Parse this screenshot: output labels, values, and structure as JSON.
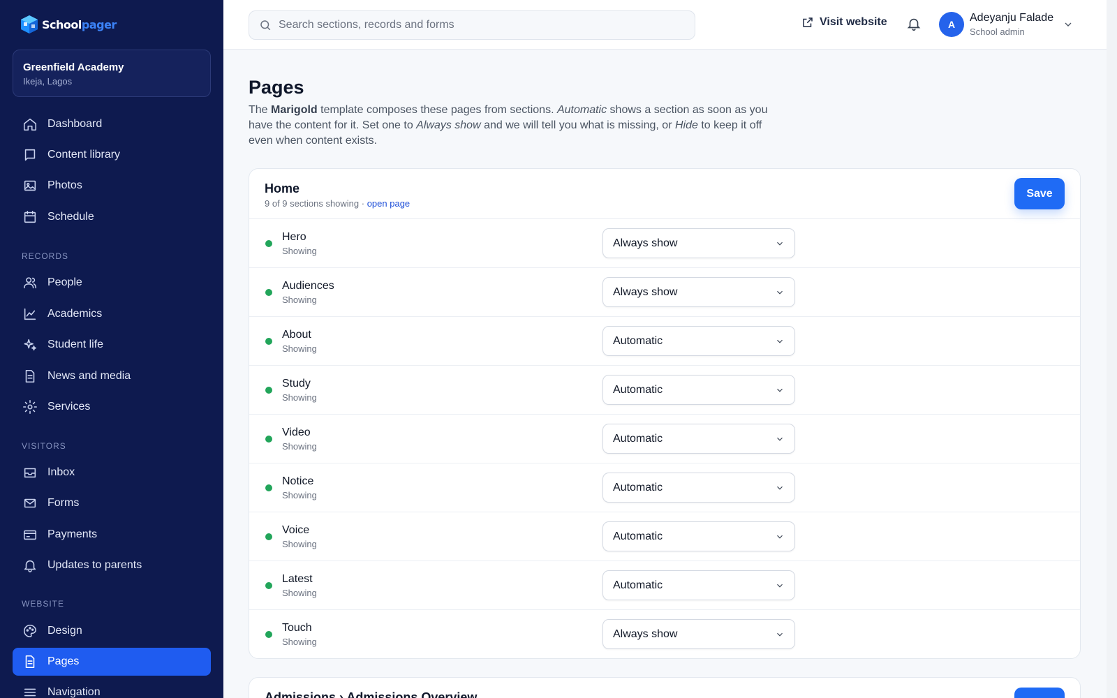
{
  "brand": {
    "word1": "School",
    "word2": "pager",
    "primary_color": "#1f5cf0",
    "sidebar_bg": "#0e1a4f"
  },
  "school": {
    "name": "Greenfield Academy",
    "location": "Ikeja, Lagos"
  },
  "nav": {
    "main": [
      {
        "label": "Dashboard",
        "icon": "home-icon"
      },
      {
        "label": "Content library",
        "icon": "book-icon"
      },
      {
        "label": "Photos",
        "icon": "image-icon"
      },
      {
        "label": "Schedule",
        "icon": "calendar-icon"
      }
    ],
    "records_label": "RECORDS",
    "records": [
      {
        "label": "People",
        "icon": "users-icon"
      },
      {
        "label": "Academics",
        "icon": "chart-icon"
      },
      {
        "label": "Student life",
        "icon": "sparkles-icon"
      },
      {
        "label": "News and media",
        "icon": "document-icon"
      },
      {
        "label": "Services",
        "icon": "gear-icon"
      }
    ],
    "visitors_label": "VISITORS",
    "visitors": [
      {
        "label": "Inbox",
        "icon": "inbox-icon"
      },
      {
        "label": "Forms",
        "icon": "mail-icon"
      },
      {
        "label": "Payments",
        "icon": "credit-card-icon"
      },
      {
        "label": "Updates to parents",
        "icon": "bell-icon"
      }
    ],
    "website_label": "WEBSITE",
    "website": [
      {
        "label": "Design",
        "icon": "palette-icon"
      },
      {
        "label": "Pages",
        "icon": "page-icon",
        "active": true
      },
      {
        "label": "Navigation",
        "icon": "menu-icon"
      }
    ]
  },
  "topbar": {
    "search_placeholder": "Search sections, records and forms",
    "visit_label": "Visit website",
    "user_initial": "A",
    "user_name": "Adeyanju Falade",
    "user_role": "School admin"
  },
  "page": {
    "title": "Pages",
    "desc_pre": "The ",
    "desc_template": "Marigold",
    "desc_mid1": " template composes these pages from sections. ",
    "desc_auto": "Automatic",
    "desc_mid2": " shows a section as soon as you have the content for it. Set one to ",
    "desc_always": "Always show",
    "desc_mid3": " and we will tell you what is missing, or ",
    "desc_hide": "Hide",
    "desc_post": " to keep it off even when content exists."
  },
  "home_card": {
    "title": "Home",
    "summary": "9 of 9 sections showing · ",
    "open_link": "open page",
    "save_label": "Save",
    "status_color": "#22a55a",
    "sections": [
      {
        "name": "Hero",
        "status": "Showing",
        "mode": "Always show"
      },
      {
        "name": "Audiences",
        "status": "Showing",
        "mode": "Always show"
      },
      {
        "name": "About",
        "status": "Showing",
        "mode": "Automatic"
      },
      {
        "name": "Study",
        "status": "Showing",
        "mode": "Automatic"
      },
      {
        "name": "Video",
        "status": "Showing",
        "mode": "Automatic"
      },
      {
        "name": "Notice",
        "status": "Showing",
        "mode": "Automatic"
      },
      {
        "name": "Voice",
        "status": "Showing",
        "mode": "Automatic"
      },
      {
        "name": "Latest",
        "status": "Showing",
        "mode": "Automatic"
      },
      {
        "name": "Touch",
        "status": "Showing",
        "mode": "Always show"
      }
    ]
  },
  "next_card": {
    "title": "Admissions › Admissions Overview"
  }
}
